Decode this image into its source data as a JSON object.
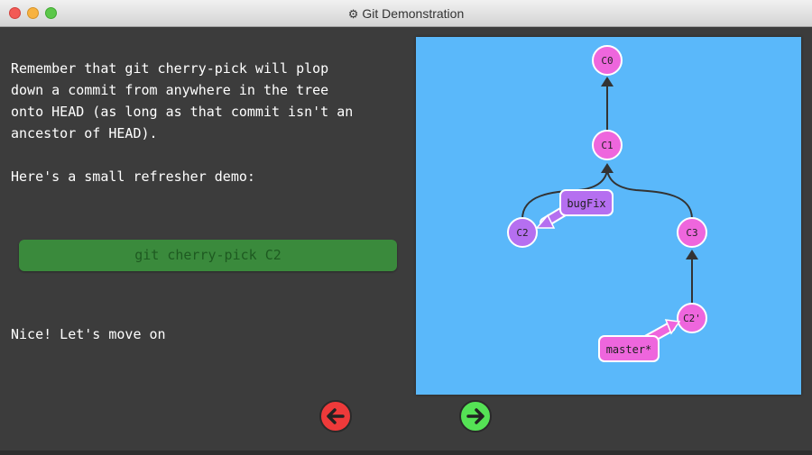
{
  "window": {
    "title": "Git Demonstration",
    "title_icon": "gear-icon"
  },
  "content": {
    "paragraph_lines": [
      "Remember that git cherry-pick will plop",
      "down a commit from anywhere in the tree",
      "onto HEAD (as long as that commit isn't an",
      "ancestor of HEAD)."
    ],
    "refresher": "Here's a small refresher demo:",
    "command": "git cherry-pick C2",
    "done": "Nice! Let's move on"
  },
  "graph": {
    "commits": {
      "c0": "C0",
      "c1": "C1",
      "c2": "C2",
      "c3": "C3",
      "c2p": "C2'"
    },
    "branches": {
      "bugfix": "bugFix",
      "master": "master*"
    }
  },
  "colors": {
    "background": "#3c3c3c",
    "visualization_bg": "#5ab8fa",
    "command_bg": "#3a8a3c",
    "commit_main": "#ee66dd",
    "commit_branch": "#b56ff0",
    "back_button": "#ee3a3a",
    "forward_button": "#55e255"
  },
  "navigation": {
    "back_icon": "arrow-left-icon",
    "forward_icon": "arrow-right-icon"
  }
}
